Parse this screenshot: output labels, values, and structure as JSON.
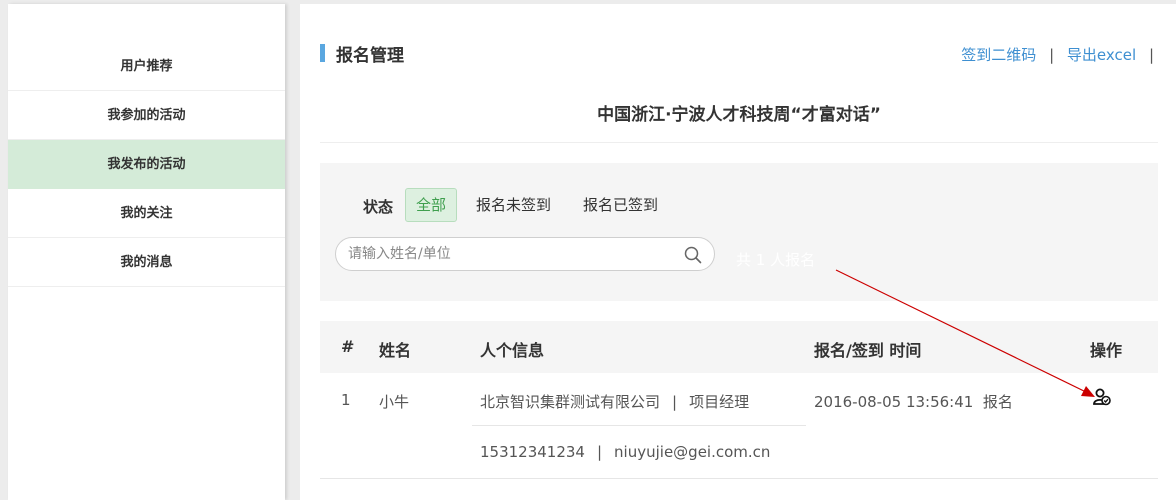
{
  "sidebar": {
    "items": [
      {
        "label": "用户推荐"
      },
      {
        "label": "我参加的活动"
      },
      {
        "label": "我发布的活动"
      },
      {
        "label": "我的关注"
      },
      {
        "label": "我的消息"
      }
    ],
    "active_index": 2
  },
  "header": {
    "title": "报名管理",
    "links": {
      "qrcode": "签到二维码",
      "export": "导出excel",
      "separator": "|"
    }
  },
  "event": {
    "title": "中国浙江·宁波人才科技周“才富对话”"
  },
  "filter": {
    "status_label": "状态",
    "tabs": [
      {
        "label": "全部",
        "active": true
      },
      {
        "label": "报名未签到",
        "active": false
      },
      {
        "label": "报名已签到",
        "active": false
      }
    ],
    "search_placeholder": "请输入姓名/单位",
    "search_icon": "search-icon",
    "count_text": "共 1 人报名"
  },
  "table": {
    "headers": {
      "index": "#",
      "name": "姓名",
      "info": "人个信息",
      "time": "报名/签到 时间",
      "action": "操作"
    },
    "rows": [
      {
        "index": "1",
        "name": "小牛",
        "company": "北京智识集群测试有限公司",
        "position": "项目经理",
        "phone": "15312341234",
        "email": "niuyujie@gei.com.cn",
        "separator": "|",
        "time": "2016-08-05 13:56:41",
        "status": "报名",
        "action_icon": "user-check-icon"
      }
    ]
  },
  "colors": {
    "accent_blue": "#3e8fd1",
    "active_green_bg": "#d4ebd8",
    "tab_active_text": "#3f9f4e",
    "annotation_red": "#cc0000"
  }
}
